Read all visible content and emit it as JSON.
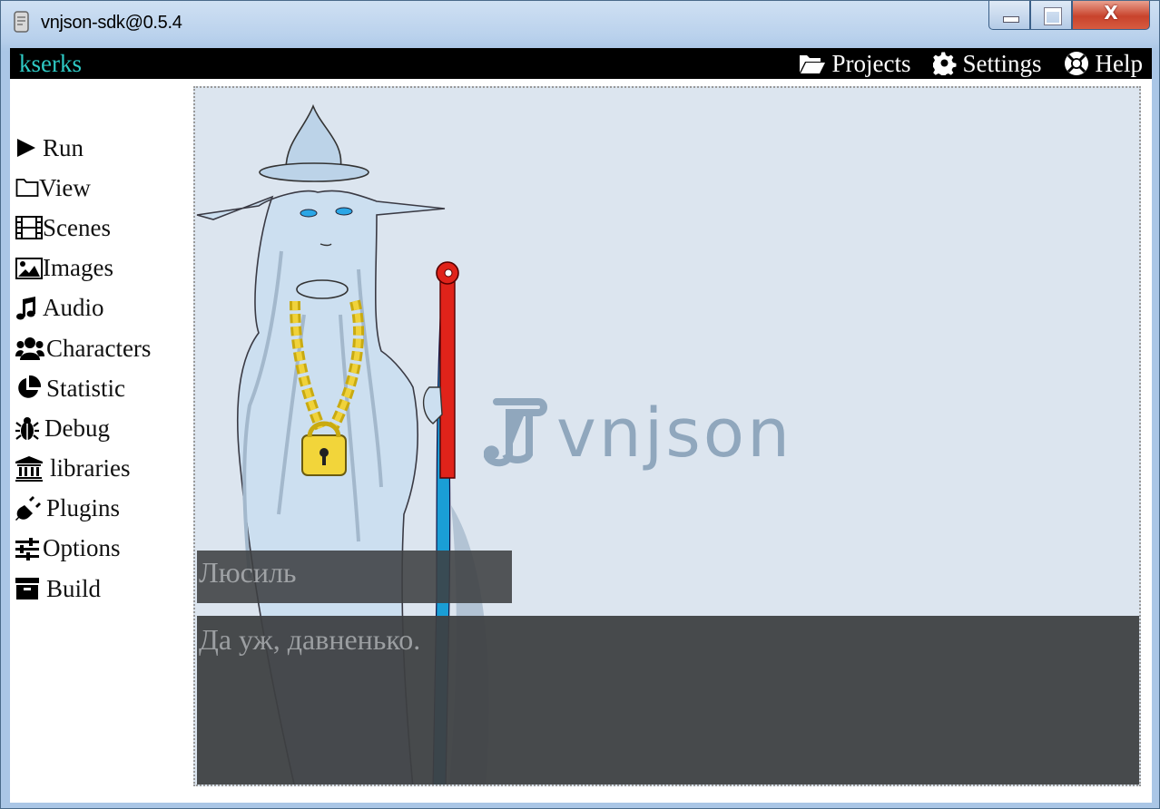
{
  "window": {
    "title": "vnjson-sdk@0.5.4",
    "close_label": "X"
  },
  "menubar": {
    "brand": "kserks",
    "nav": [
      {
        "label": "Projects",
        "icon": "folder-open-icon"
      },
      {
        "label": "Settings",
        "icon": "gear-icon"
      },
      {
        "label": "Help",
        "icon": "life-ring-icon"
      }
    ]
  },
  "sidebar": {
    "items": [
      {
        "label": "Run",
        "icon": "play-icon"
      },
      {
        "label": "View",
        "icon": "folder-icon"
      },
      {
        "label": "Scenes",
        "icon": "film-icon"
      },
      {
        "label": "Images",
        "icon": "image-icon"
      },
      {
        "label": "Audio",
        "icon": "music-icon"
      },
      {
        "label": "Characters",
        "icon": "users-icon"
      },
      {
        "label": "Statistic",
        "icon": "pie-chart-icon"
      },
      {
        "label": "Debug",
        "icon": "bug-icon"
      },
      {
        "label": "libraries",
        "icon": "bank-icon"
      },
      {
        "label": "Plugins",
        "icon": "plug-icon"
      },
      {
        "label": "Options",
        "icon": "sliders-icon"
      },
      {
        "label": "Build",
        "icon": "archive-icon"
      }
    ]
  },
  "stage": {
    "logo_text": "vnjson",
    "character_name": "Люсиль",
    "dialog_text": "Да уж, давненько."
  },
  "colors": {
    "brand": "#2ec9c4",
    "menubar_bg": "#000000",
    "stage_bg": "#dce5ef",
    "textbox_bg": "#3e4042"
  }
}
